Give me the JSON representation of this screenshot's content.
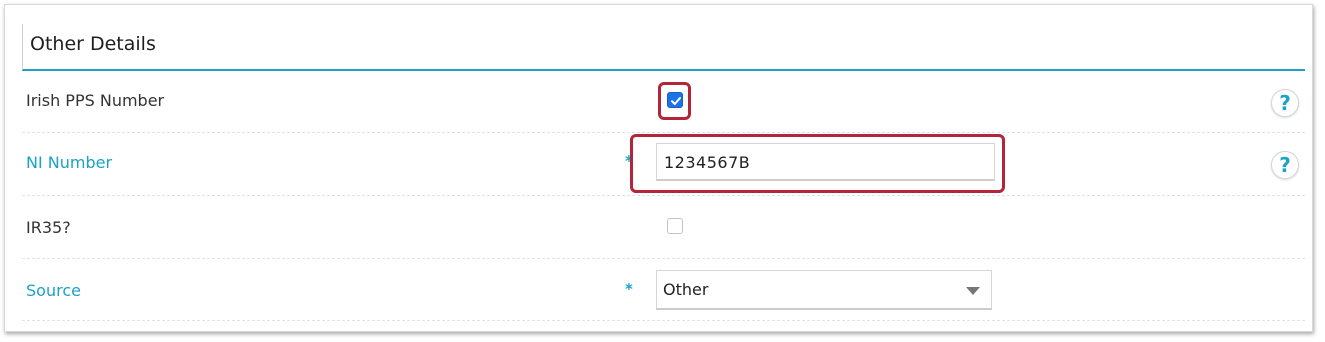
{
  "section": {
    "title": "Other Details"
  },
  "fields": {
    "irish_pps": {
      "label": "Irish PPS Number",
      "checked": true,
      "help_icon": "?"
    },
    "ni_number": {
      "label": "NI Number",
      "required_mark": "*",
      "value": "1234567B",
      "help_icon": "?"
    },
    "ir35": {
      "label": "IR35?",
      "checked": false
    },
    "source": {
      "label": "Source",
      "required_mark": "*",
      "selected": "Other"
    }
  },
  "colors": {
    "accent": "#1ba3c6",
    "highlight": "#b3263a",
    "checkbox_checked": "#1a73e8"
  }
}
